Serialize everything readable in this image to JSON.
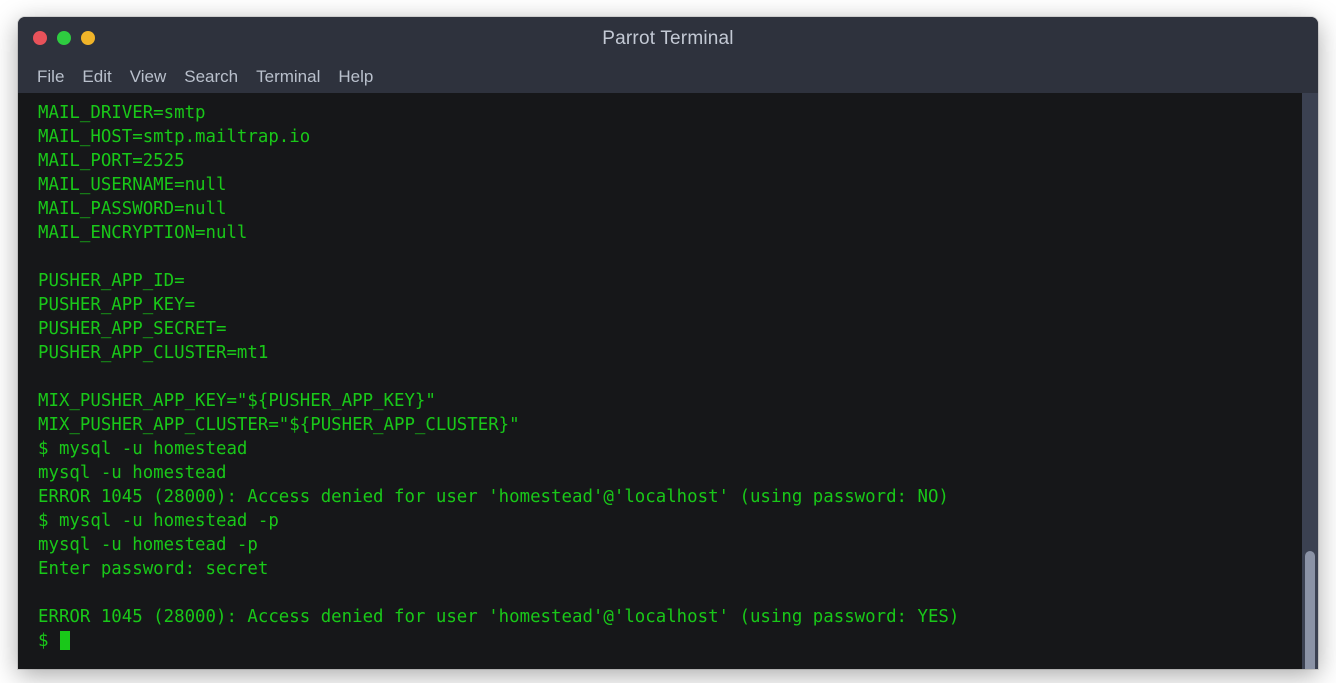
{
  "window": {
    "title": "Parrot Terminal",
    "controls": [
      {
        "name": "close",
        "color": "#e8525a"
      },
      {
        "name": "minimize",
        "color": "#2ecc40"
      },
      {
        "name": "maximize",
        "color": "#f0b429"
      }
    ]
  },
  "menubar": {
    "items": [
      {
        "label": "File"
      },
      {
        "label": "Edit"
      },
      {
        "label": "View"
      },
      {
        "label": "Search"
      },
      {
        "label": "Terminal"
      },
      {
        "label": "Help"
      }
    ]
  },
  "terminal": {
    "foreground": "#19c819",
    "background": "#161719",
    "prompt_symbol": "$",
    "cursor": "block",
    "lines": [
      "MAIL_DRIVER=smtp",
      "MAIL_HOST=smtp.mailtrap.io",
      "MAIL_PORT=2525",
      "MAIL_USERNAME=null",
      "MAIL_PASSWORD=null",
      "MAIL_ENCRYPTION=null",
      "",
      "PUSHER_APP_ID=",
      "PUSHER_APP_KEY=",
      "PUSHER_APP_SECRET=",
      "PUSHER_APP_CLUSTER=mt1",
      "",
      "MIX_PUSHER_APP_KEY=\"${PUSHER_APP_KEY}\"",
      "MIX_PUSHER_APP_CLUSTER=\"${PUSHER_APP_CLUSTER}\"",
      "$ mysql -u homestead",
      "mysql -u homestead",
      "ERROR 1045 (28000): Access denied for user 'homestead'@'localhost' (using password: NO)",
      "$ mysql -u homestead -p",
      "mysql -u homestead -p",
      "Enter password: secret",
      "",
      "ERROR 1045 (28000): Access denied for user 'homestead'@'localhost' (using password: YES)"
    ],
    "last_line_prompt": "$ "
  },
  "scrollbar": {
    "track_color": "#3b4151",
    "thumb_color": "#8b93a6"
  }
}
